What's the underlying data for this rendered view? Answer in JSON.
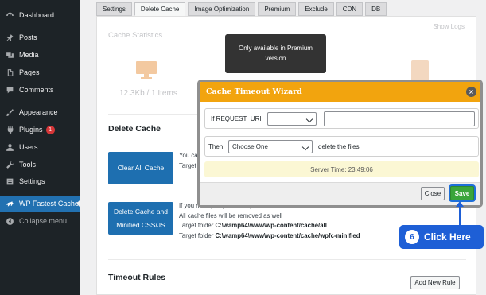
{
  "sidebar": {
    "items": [
      {
        "label": "Dashboard",
        "icon": "dashboard-icon"
      },
      {
        "label": "Posts",
        "icon": "pin-icon"
      },
      {
        "label": "Media",
        "icon": "media-icon"
      },
      {
        "label": "Pages",
        "icon": "pages-icon"
      },
      {
        "label": "Comments",
        "icon": "comment-icon"
      },
      {
        "label": "Appearance",
        "icon": "brush-icon"
      },
      {
        "label": "Plugins",
        "icon": "plugin-icon",
        "badge": "1"
      },
      {
        "label": "Users",
        "icon": "user-icon"
      },
      {
        "label": "Tools",
        "icon": "wrench-icon"
      },
      {
        "label": "Settings",
        "icon": "settings-icon"
      },
      {
        "label": "WP Fastest Cache",
        "icon": "cheetah-icon",
        "active": true
      },
      {
        "label": "Collapse menu",
        "icon": "collapse-icon"
      }
    ]
  },
  "tabs": [
    "Settings",
    "Delete Cache",
    "Image Optimization",
    "Premium",
    "Exclude",
    "CDN",
    "DB"
  ],
  "active_tab": "Delete Cache",
  "cache_stats": {
    "title": "Cache Statistics",
    "show_logs": "Show Logs",
    "value": "12.3Kb / 1 Items"
  },
  "delete_cache": {
    "title": "Delete Cache",
    "clear_all_label": "Clear All Cache",
    "clear_desc": [
      "You can",
      "Target f"
    ],
    "delete_minified_label": [
      "Delete Cache and",
      "Minified CSS/JS"
    ],
    "minified_desc": {
      "line1": "If you modify any css file, you have to delete minified css files",
      "line2": "All cache files will be removed as well",
      "line3_prefix": "Target folder ",
      "line3_path": "C:\\wamp64\\www\\wp-content/cache/all",
      "line4_prefix": "Target folder ",
      "line4_path": "C:\\wamp64\\www\\wp-content/cache/wpfc-minified"
    }
  },
  "timeout_rules": {
    "title": "Timeout Rules",
    "add_rule_label": "Add New Rule"
  },
  "tooltip": {
    "text": "Only available in Premium version"
  },
  "modal": {
    "title": "Cache Timeout Wizard",
    "close_icon": "×",
    "if_label": "If REQUEST_URI",
    "if_select_value": "",
    "if_input_value": "",
    "then_label": "Then",
    "then_select_value": "Choose One",
    "then_suffix": "delete the files",
    "server_time": "Server Time: 23:49:06",
    "close_label": "Close",
    "save_label": "Save"
  },
  "callout": {
    "number": "6",
    "text": "Click Here"
  },
  "colors": {
    "sidebar_bg": "#1d2327",
    "active_blue": "#2271b1",
    "modal_header": "#f2a40e",
    "save_green": "#3aa53a",
    "callout_blue": "#1e5fd6"
  }
}
